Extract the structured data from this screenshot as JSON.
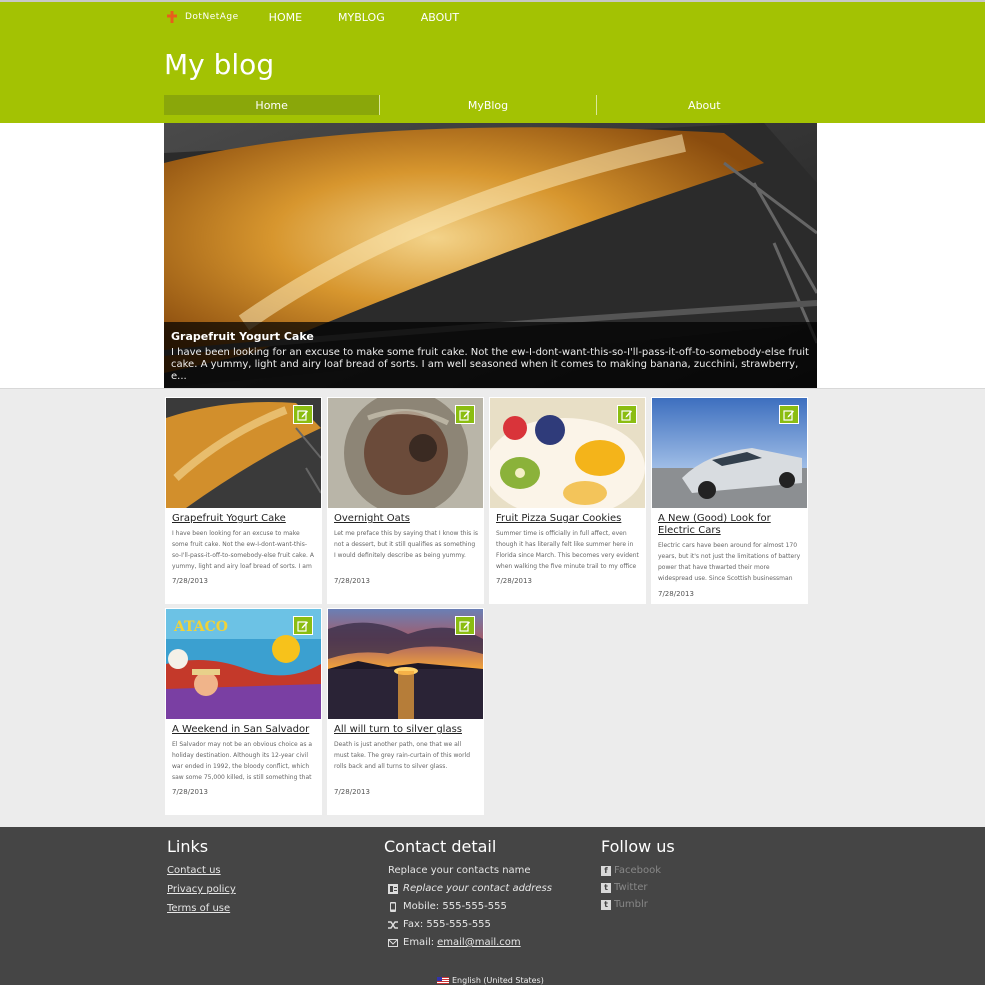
{
  "brand": {
    "name": "DotNetAge"
  },
  "topnav": [
    "HOME",
    "MYBLOG",
    "ABOUT"
  ],
  "site_title": "My blog",
  "mainnav": {
    "items": [
      "Home",
      "MyBlog",
      "About"
    ],
    "active": "Home"
  },
  "hero": {
    "title": "Grapefruit Yogurt Cake",
    "text": "I have been looking for an excuse to make some fruit cake. Not the ew-I-dont-want-this-so-I'll-pass-it-off-to-somebody-else fruit cake. A yummy, light and airy loaf bread of sorts. I am well seasoned when it comes to making banana, zucchini, strawberry, e..."
  },
  "posts": [
    {
      "title": "Grapefruit Yogurt Cake",
      "excerpt": "I have been looking for an excuse to make some fruit cake. Not the ew-I-dont-want-this-so-I'll-pass-it-off-to-somebody-else fruit cake. A yummy, light and airy loaf bread of sorts. I am",
      "date": "7/28/2013"
    },
    {
      "title": "Overnight Oats",
      "excerpt": "Let me preface this by saying that I know this is not a dessert, but it still qualifies as something I would definitely describe as being yummy.",
      "date": "7/28/2013"
    },
    {
      "title": "Fruit Pizza Sugar Cookies",
      "excerpt": "Summer time is officially in full affect, even though it has literally felt like summer here in Florida since March. This becomes very evident when walking the five minute trail to my office",
      "date": "7/28/2013"
    },
    {
      "title": "A New (Good) Look for Electric Cars",
      "excerpt": "Electric cars have been around for almost 170 years, but it's not just the limitations of battery power that have thwarted their more widespread use. Since Scottish businessman",
      "date": "7/28/2013"
    },
    {
      "title": "A Weekend in San Salvador",
      "excerpt": "El Salvador may not be an obvious choice as a holiday destination. Although its 12-year civil war ended in 1992, the bloody conflict, which saw some 75,000 killed, is still something that",
      "date": "7/28/2013"
    },
    {
      "title": "All will turn to silver glass",
      "excerpt": "Death is just another path, one that we all must take. The grey rain-curtain of this world rolls back and all turns to silver glass.",
      "date": "7/28/2013"
    }
  ],
  "footer": {
    "links_heading": "Links",
    "links": [
      "Contact us",
      "Privacy policy",
      "Terms of use"
    ],
    "contact_heading": "Contact detail",
    "contact_name": "Replace your contacts name",
    "contact_address": "Replace your contact address",
    "mobile": "Mobile: 555-555-555",
    "fax": "Fax: 555-555-555",
    "email_label": "Email:",
    "email": "email@mail.com",
    "follow_heading": "Follow us",
    "social": [
      "Facebook",
      "Twitter",
      "Tumblr"
    ],
    "language": "English (United States)"
  },
  "colors": {
    "header": "#a3c203",
    "nav_active": "#8aa70a",
    "edit_button": "#8bbd11",
    "footer": "#454545"
  }
}
